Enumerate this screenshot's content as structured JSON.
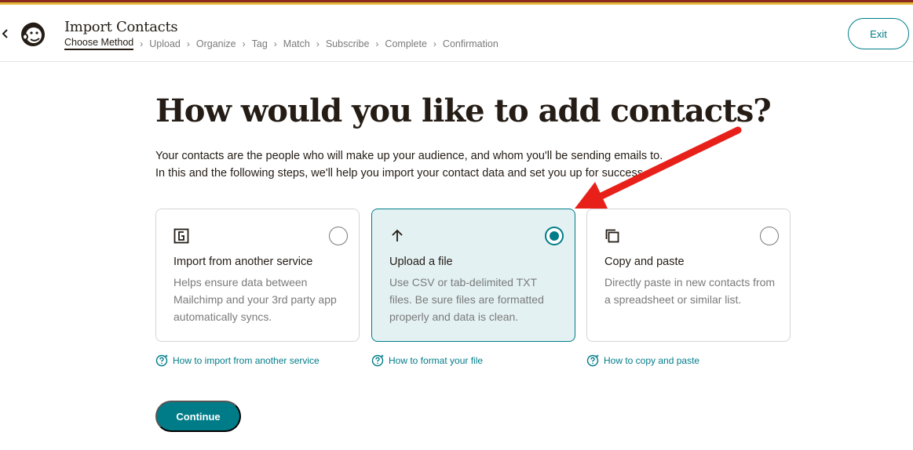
{
  "header": {
    "title": "Import Contacts",
    "breadcrumbs": [
      "Choose Method",
      "Upload",
      "Organize",
      "Tag",
      "Match",
      "Subscribe",
      "Complete",
      "Confirmation"
    ],
    "exit_label": "Exit"
  },
  "main": {
    "heading": "How would you like to add contacts?",
    "intro_line1": "Your contacts are the people who will make up your audience, and whom you'll be sending emails to.",
    "intro_line2": "In this and the following steps, we'll help you import your contact data and set you up for success.",
    "options": [
      {
        "title": "Import from another service",
        "description": "Helps ensure data between Mailchimp and your 3rd party app automatically syncs.",
        "help_link": "How to import from another service",
        "icon": "integration-icon",
        "selected": false
      },
      {
        "title": "Upload a file",
        "description": "Use CSV or tab-delimited TXT files. Be sure files are formatted properly and data is clean.",
        "help_link": "How to format your file",
        "icon": "upload-arrow-icon",
        "selected": true
      },
      {
        "title": "Copy and paste",
        "description": "Directly paste in new contacts from a spreadsheet or similar list.",
        "help_link": "How to copy and paste",
        "icon": "copy-icon",
        "selected": false
      }
    ],
    "continue_label": "Continue"
  },
  "colors": {
    "accent": "#007c89",
    "selected_bg": "#e3f1f2",
    "annotation_arrow": "#e8201a"
  }
}
